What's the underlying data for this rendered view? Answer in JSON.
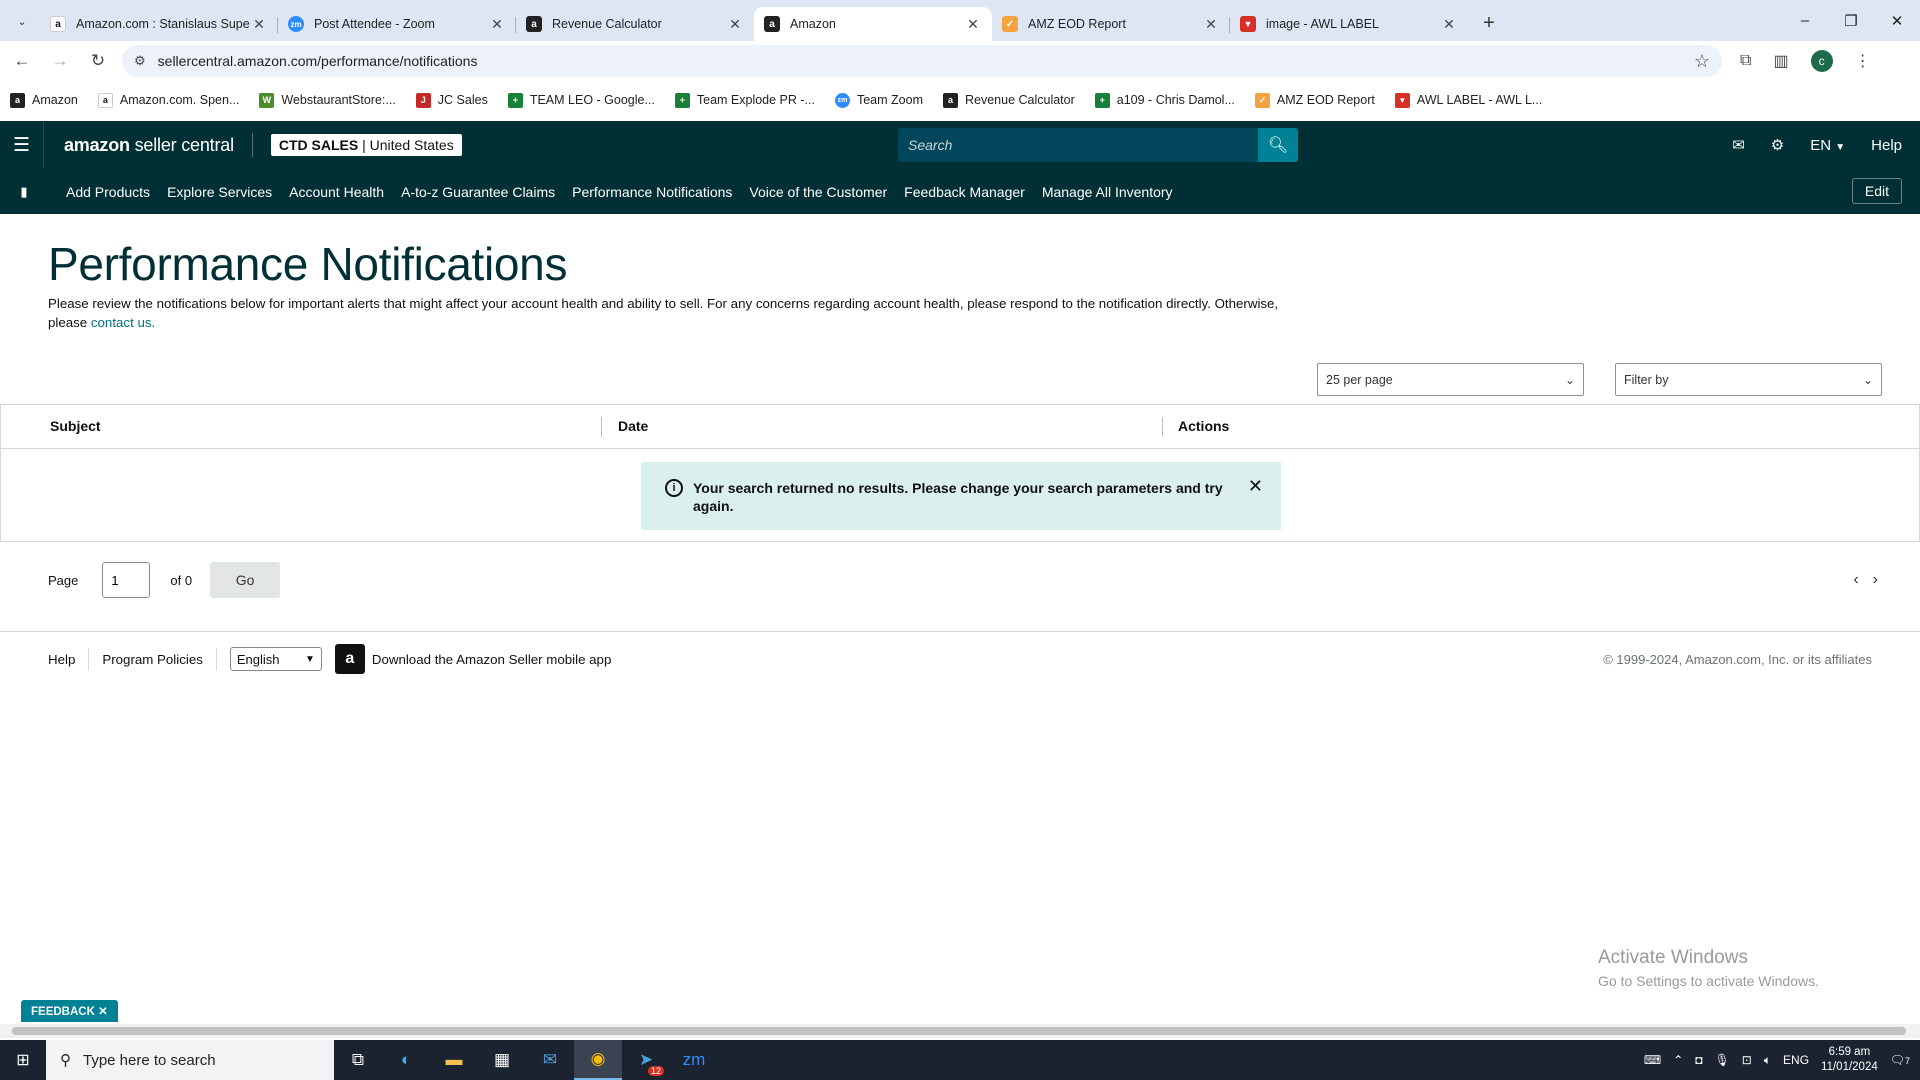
{
  "browser": {
    "tabs": [
      {
        "title": "Amazon.com : Stanislaus Supe",
        "icon": "amazon-favicon",
        "active": false
      },
      {
        "title": "Post Attendee - Zoom",
        "icon": "zoom-favicon",
        "active": false
      },
      {
        "title": "Revenue Calculator",
        "icon": "amazon-favicon",
        "active": false
      },
      {
        "title": "Amazon",
        "icon": "amazon-favicon",
        "active": true
      },
      {
        "title": "AMZ EOD Report",
        "icon": "report-favicon",
        "active": false
      },
      {
        "title": "image - AWL LABEL",
        "icon": "awl-favicon",
        "active": false
      }
    ],
    "url": "sellercentral.amazon.com/performance/notifications",
    "profile_initial": "c",
    "bookmarks": [
      {
        "label": "Amazon",
        "icon": "amazon-favicon"
      },
      {
        "label": "Amazon.com. Spen...",
        "icon": "amazon-favicon"
      },
      {
        "label": "WebstaurantStore:...",
        "icon": "webstaurant-favicon"
      },
      {
        "label": "JC Sales",
        "icon": "jcsales-favicon"
      },
      {
        "label": "TEAM LEO - Google...",
        "icon": "sheets-favicon"
      },
      {
        "label": "Team Explode PR -...",
        "icon": "sheets-favicon"
      },
      {
        "label": "Team Zoom",
        "icon": "zoom-favicon"
      },
      {
        "label": "Revenue Calculator",
        "icon": "amazon-favicon"
      },
      {
        "label": "a109 - Chris Damol...",
        "icon": "sheets-favicon"
      },
      {
        "label": "AMZ EOD Report",
        "icon": "report-favicon"
      },
      {
        "label": "AWL LABEL - AWL L...",
        "icon": "awl-favicon"
      }
    ]
  },
  "header": {
    "logo_brand": "amazon",
    "logo_rest": " seller central",
    "store_name": "CTD SALES",
    "store_region": "United States",
    "search_placeholder": "Search",
    "language": "EN",
    "help": "Help"
  },
  "nav": {
    "items": [
      "Add Products",
      "Explore Services",
      "Account Health",
      "A-to-z Guarantee Claims",
      "Performance Notifications",
      "Voice of the Customer",
      "Feedback Manager",
      "Manage All Inventory"
    ],
    "edit": "Edit"
  },
  "main": {
    "title": "Performance Notifications",
    "intro_text": "Please review the notifications below for important alerts that might affect your account health and ability to sell. For any concerns regarding account health, please respond to the notification directly. Otherwise, please ",
    "intro_link": "contact us.",
    "per_page": "25 per page",
    "filter_placeholder": "Filter by",
    "columns": [
      "Subject",
      "Date",
      "Actions"
    ],
    "alert_message": "Your search returned no results. Please change your search parameters and try again.",
    "pager": {
      "page_label": "Page",
      "page_value": "1",
      "of_label": "of 0",
      "go": "Go"
    }
  },
  "footer": {
    "help": "Help",
    "program_policies": "Program Policies",
    "language": "English",
    "app_text": "Download the Amazon Seller mobile app",
    "copyright": "© 1999-2024, Amazon.com, Inc. or its affiliates"
  },
  "watermark": {
    "line1": "Activate Windows",
    "line2": "Go to Settings to activate Windows."
  },
  "feedback": "FEEDBACK",
  "taskbar": {
    "search_placeholder": "Type here to search",
    "language": "ENG",
    "time": "6:59 am",
    "date": "11/01/2024",
    "badge_count": "12",
    "notification_count": "7"
  },
  "colors": {
    "header_bg": "#002f36",
    "accent": "#008296",
    "alert_bg": "#dcefef",
    "link": "#007185"
  }
}
